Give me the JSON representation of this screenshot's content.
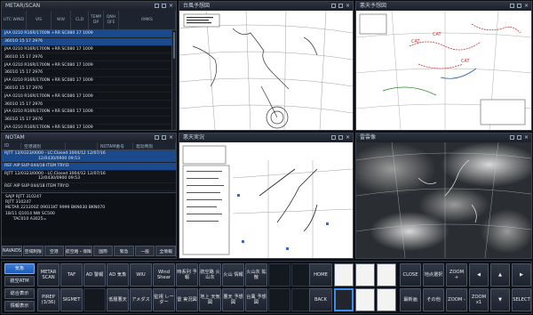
{
  "metar": {
    "title": "METAR/SCAN",
    "columns": [
      "UTC WIND",
      "VIS",
      "WW",
      "CLD",
      "TEMP DP",
      "QNH QFE",
      "RMKS"
    ],
    "rows": [
      {
        "text": "JAA 0210 R16R/1700N +RR SC080 17 1009",
        "sel": true
      },
      {
        "text": "3601O 15 17 2976",
        "sel": true
      },
      {
        "text": "JAA 0210 R16R/1700N +RR SC080 17 1009",
        "sel": false
      },
      {
        "text": "3601O 15 17 2976",
        "sel": false
      },
      {
        "text": "JAA 0210 R16R/1700N +RR SC080 17 1009",
        "sel": false
      },
      {
        "text": "3601O 15 17 2976",
        "sel": false
      },
      {
        "text": "JAA 0210 R16R/1700N +RR SC080 17 1009",
        "sel": false
      },
      {
        "text": "3601O 15 17 2976",
        "sel": false
      },
      {
        "text": "JAA 0210 R16R/1700N +RR SC080 17 1009",
        "sel": false
      },
      {
        "text": "3601O 15 17 2976",
        "sel": false
      },
      {
        "text": "JAA 0210 R16R/1700N +RR SC080 17 1009",
        "sel": false
      },
      {
        "text": "3601O 15 17 2976",
        "sel": false
      },
      {
        "text": "JAA 0210 R16R/1700N +RR SC080 17 1009",
        "sel": false
      }
    ]
  },
  "maps": {
    "top_center": {
      "title": "台風予想図"
    },
    "top_right": {
      "title": "悪天予想図"
    },
    "mid_center": {
      "title": "悪天実況"
    },
    "mid_right": {
      "title": "雷雲像"
    }
  },
  "notam": {
    "title": "NOTAM",
    "tabs": [
      "ID",
      "空港識別",
      "",
      "NOTAM番号",
      "発効時刻"
    ],
    "rows": [
      {
        "l1": "RJTT 12/0323/0000 - LC:Closed 3004/12 12/07/16",
        "l2": "12/0430/0900 09:53",
        "sel": true
      },
      {
        "l1": "REF AIP SUP 044/18 ITEM TRY:D",
        "l2": "",
        "sel": true
      },
      {
        "l1": "RJTT 12/0323/0000 - LC:Closed 3004/12 12/07/16",
        "l2": "12/0430/0900 09:53",
        "sel": false
      },
      {
        "l1": "REF AIP SUP 044/18 ITEM TRY:D",
        "l2": "",
        "sel": false
      }
    ],
    "detail": "SAJP RJTT 310247\nRJTT 310247\nMETAR 221200Z 09011KT 9999 BKN030 BKN070\n18/11 Q1014 NW SC500\n      TAC010 A3025=",
    "buttons": [
      "NAVAIDS",
      "空域制限",
      "空港",
      "航空路・保障",
      "国際",
      "緊急",
      "一般",
      "全情報"
    ]
  },
  "bottom": {
    "left_col": [
      "気象",
      "航空ATM",
      "総合表示",
      "情報表示"
    ],
    "grid_row1": [
      "METAR SCAN",
      "TAF",
      "AD 警報",
      "AD 気象",
      "WIU",
      "Wind Shear",
      "時系列 予報",
      "航空路 火山灰",
      "火山 情報",
      "火山灰 拡散"
    ],
    "grid_row2": [
      "PIREP (3/36)",
      "SIGMET",
      "",
      "低層悪天",
      "アメダス",
      "監視 レーダー",
      "雷 実況図",
      "地上 天気図",
      "悪天 予想図",
      "台風 予想図"
    ],
    "nav": {
      "home": "HOME",
      "back": "BACK",
      "close": "CLOSE",
      "layer": "地点選択",
      "zoom_in": "ZOOM +",
      "zoom_out": "ZOOM -",
      "delete": "最新画",
      "other": "その他",
      "zoom_reset": "ZOOM x1",
      "select": "SELECT",
      "left": "◀",
      "up": "▲",
      "right": "▶",
      "down": "▼"
    }
  },
  "colors": {
    "accent": "#1e5bb8",
    "selected_row": "#1a4a8c",
    "panel_bg": "#101318"
  }
}
